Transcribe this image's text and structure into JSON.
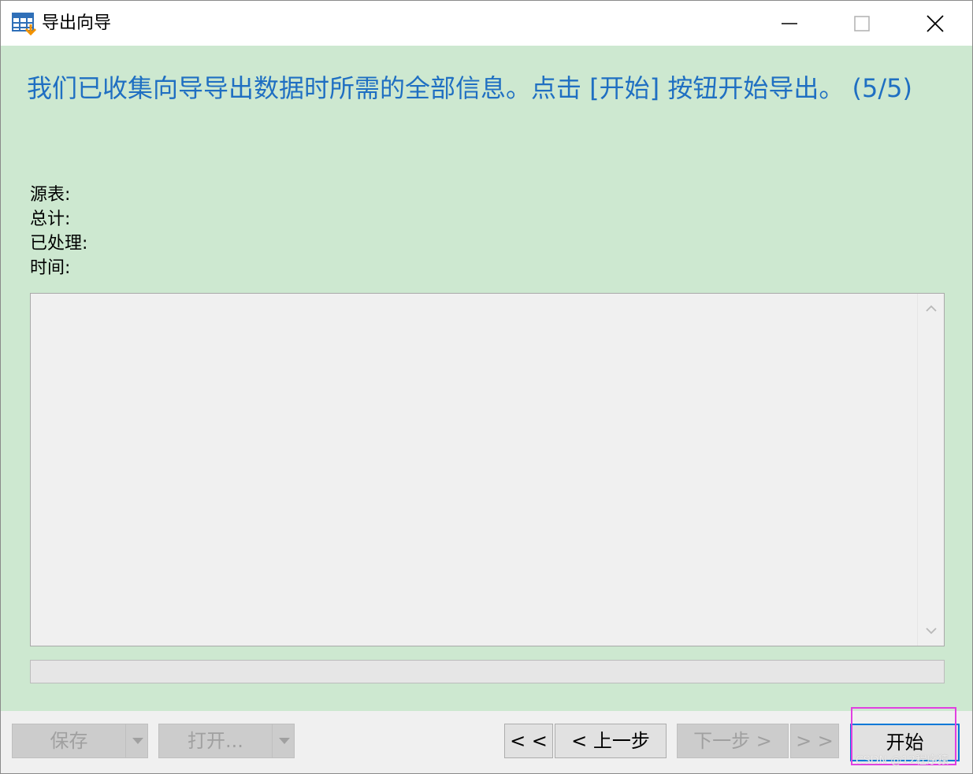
{
  "window": {
    "title": "导出向导"
  },
  "header": {
    "message": "我们已收集向导导出数据时所需的全部信息。点击 [开始] 按钮开始导出。 (5/5)"
  },
  "info": {
    "source_table_label": "源表:",
    "total_label": "总计:",
    "processed_label": "已处理:",
    "time_label": "时间:"
  },
  "progress": {
    "fraction": 0
  },
  "buttons": {
    "save": "保存",
    "open": "打开...",
    "first": "< <",
    "prev": "< 上一步",
    "next": "下一步 >",
    "last": "> >",
    "start": "开始"
  },
  "watermark": "CSDN @12程序猿",
  "colors": {
    "panel_bg": "#cde8d0",
    "header_text": "#1f6fc2",
    "highlight_border": "#e040e0",
    "start_border": "#0078d7"
  },
  "icons": {
    "app": "table-export-icon",
    "minimize": "minimize-icon",
    "maximize": "maximize-icon",
    "close": "close-icon",
    "scroll_up": "chevron-up-icon",
    "scroll_down": "chevron-down-icon",
    "dropdown": "triangle-down-icon"
  }
}
